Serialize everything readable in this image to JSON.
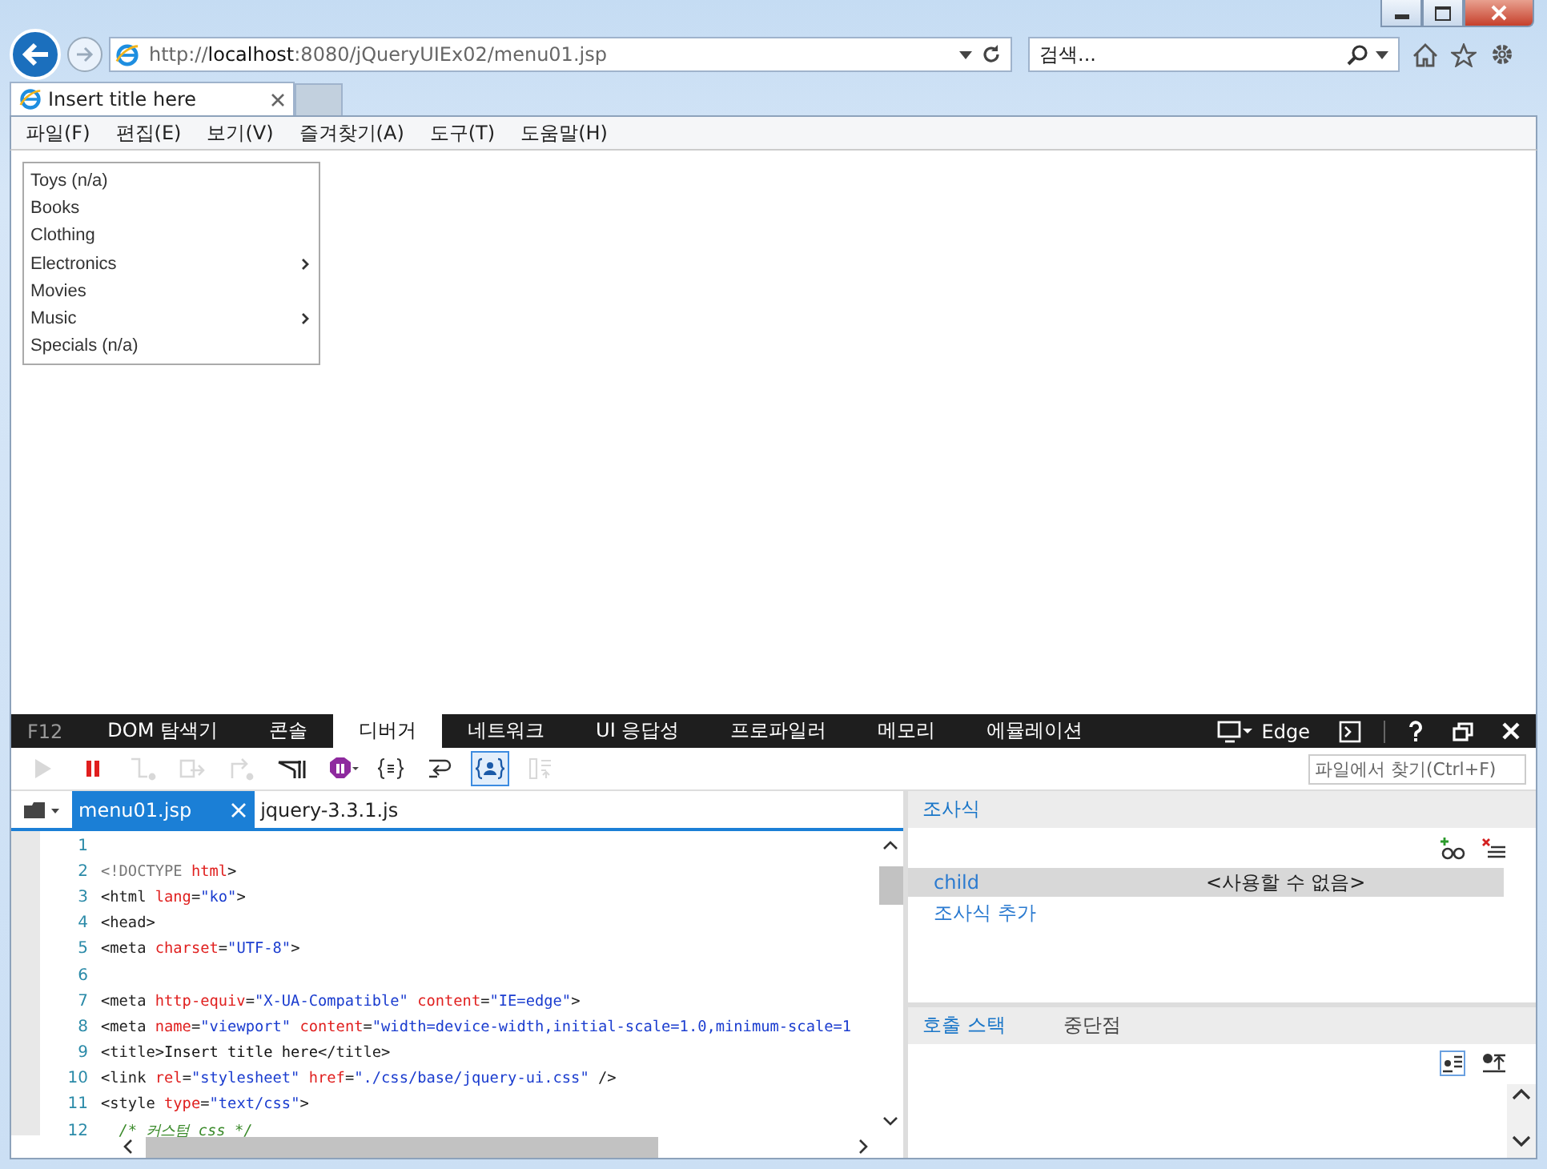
{
  "browser": {
    "url": "http://**localhost**:8080/jQueryUIEx02/menu01.jsp",
    "search": {
      "placeholder": "검색..."
    },
    "tabs": [
      {
        "title": "Insert title here",
        "selected": true
      }
    ],
    "menu_bar": [
      "파일(F)",
      "편집(E)",
      "보기(V)",
      "즐겨찾기(A)",
      "도구(T)",
      "도움말(H)"
    ]
  },
  "page": {
    "menu": [
      {
        "label": "Toys (n/a)",
        "submenu": false
      },
      {
        "label": "Books",
        "submenu": false
      },
      {
        "label": "Clothing",
        "submenu": false
      },
      {
        "label": "Electronics",
        "submenu": true
      },
      {
        "label": "Movies",
        "submenu": false
      },
      {
        "label": "Music",
        "submenu": true
      },
      {
        "label": "Specials (n/a)",
        "submenu": false
      }
    ]
  },
  "devtools": {
    "label": "F12",
    "tabs": [
      {
        "label": "DOM 탐색기",
        "selected": false
      },
      {
        "label": "콘솔",
        "selected": false
      },
      {
        "label": "디버거",
        "selected": true
      },
      {
        "label": "네트워크",
        "selected": false
      },
      {
        "label": "UI 응답성",
        "selected": false
      },
      {
        "label": "프로파일러",
        "selected": false
      },
      {
        "label": "메모리",
        "selected": false
      },
      {
        "label": "에뮬레이션",
        "selected": false
      }
    ],
    "mode": "Edge",
    "toolbar": [
      {
        "kind": "continue",
        "disabled": true,
        "on": false
      },
      {
        "kind": "break",
        "disabled": false,
        "on": false
      },
      {
        "kind": "step-into",
        "disabled": true,
        "on": false
      },
      {
        "kind": "step-over",
        "disabled": true,
        "on": false
      },
      {
        "kind": "step-out",
        "disabled": true,
        "on": false
      },
      {
        "kind": "break-new-worker",
        "disabled": false,
        "on": false
      },
      {
        "kind": "exceptions",
        "disabled": false,
        "on": false
      },
      {
        "kind": "pretty-print",
        "disabled": false,
        "on": false
      },
      {
        "kind": "word-wrap",
        "disabled": false,
        "on": false
      },
      {
        "kind": "just-my-code",
        "disabled": false,
        "on": true
      },
      {
        "kind": "source-map",
        "disabled": true,
        "on": false
      }
    ],
    "find": {
      "placeholder": "파일에서 찾기(Ctrl+F)"
    },
    "files": [
      {
        "name": "menu01.jsp",
        "selected": true
      },
      {
        "name": "jquery-3.3.1.js",
        "selected": false
      }
    ],
    "code": [
      {
        "number": "1"
      },
      {
        "number": "2",
        "tokens": [
          {
            "kind": "doctype",
            "text": "<!DOCTYPE"
          },
          {
            "kind": "attr",
            "text": " html"
          },
          {
            "kind": "tag",
            "text": ">"
          }
        ]
      },
      {
        "number": "3",
        "tokens": [
          {
            "kind": "tag",
            "text": "<html"
          },
          {
            "kind": "attr",
            "text": " lang"
          },
          {
            "kind": "tag",
            "text": "="
          },
          {
            "kind": "value",
            "text": "\"ko\""
          },
          {
            "kind": "tag",
            "text": ">"
          }
        ]
      },
      {
        "number": "4",
        "tokens": [
          {
            "kind": "tag",
            "text": "<head>"
          }
        ]
      },
      {
        "number": "5",
        "tokens": [
          {
            "kind": "tag",
            "text": "<meta"
          },
          {
            "kind": "attr",
            "text": " charset"
          },
          {
            "kind": "tag",
            "text": "="
          },
          {
            "kind": "value",
            "text": "\"UTF-8\""
          },
          {
            "kind": "tag",
            "text": ">"
          }
        ]
      },
      {
        "number": "6"
      },
      {
        "number": "7",
        "tokens": [
          {
            "kind": "tag",
            "text": "<meta"
          },
          {
            "kind": "attr",
            "text": " http-equiv"
          },
          {
            "kind": "tag",
            "text": "="
          },
          {
            "kind": "value",
            "text": "\"X-UA-Compatible\""
          },
          {
            "kind": "attr",
            "text": " content"
          },
          {
            "kind": "tag",
            "text": "="
          },
          {
            "kind": "value",
            "text": "\"IE=edge\""
          },
          {
            "kind": "tag",
            "text": ">"
          }
        ]
      },
      {
        "number": "8",
        "tokens": [
          {
            "kind": "tag",
            "text": "<meta"
          },
          {
            "kind": "attr",
            "text": " name"
          },
          {
            "kind": "tag",
            "text": "="
          },
          {
            "kind": "value",
            "text": "\"viewport\""
          },
          {
            "kind": "attr",
            "text": " content"
          },
          {
            "kind": "tag",
            "text": "="
          },
          {
            "kind": "value",
            "text": "\"width=device-width,initial-scale=1.0,minimum-scale=1"
          }
        ]
      },
      {
        "number": "9",
        "tokens": [
          {
            "kind": "tag",
            "text": "<title>"
          },
          {
            "kind": "text",
            "text": "Insert title here"
          },
          {
            "kind": "tag",
            "text": "</title>"
          }
        ]
      },
      {
        "number": "10",
        "tokens": [
          {
            "kind": "tag",
            "text": "<link"
          },
          {
            "kind": "attr",
            "text": " rel"
          },
          {
            "kind": "tag",
            "text": "="
          },
          {
            "kind": "value",
            "text": "\"stylesheet\""
          },
          {
            "kind": "attr",
            "text": " href"
          },
          {
            "kind": "tag",
            "text": "="
          },
          {
            "kind": "value",
            "text": "\"./css/base/jquery-ui.css\""
          },
          {
            "kind": "tag",
            "text": " />"
          }
        ]
      },
      {
        "number": "11",
        "tokens": [
          {
            "kind": "tag",
            "text": "<style"
          },
          {
            "kind": "attr",
            "text": " type"
          },
          {
            "kind": "tag",
            "text": "="
          },
          {
            "kind": "value",
            "text": "\"text/css\""
          },
          {
            "kind": "tag",
            "text": ">"
          }
        ]
      },
      {
        "number": "12",
        "tokens": [
          {
            "kind": "comment",
            "text": "  /* 커스텀 css */"
          }
        ]
      }
    ],
    "watch": {
      "title": "조사식",
      "rows": [
        {
          "name": "child",
          "value": "<사용할 수 없음>",
          "selected": true
        }
      ],
      "add_label": "조사식 추가"
    },
    "bottom_tabs": [
      {
        "label": "호출 스택",
        "selected": true
      },
      {
        "label": "중단점",
        "selected": false
      }
    ]
  }
}
